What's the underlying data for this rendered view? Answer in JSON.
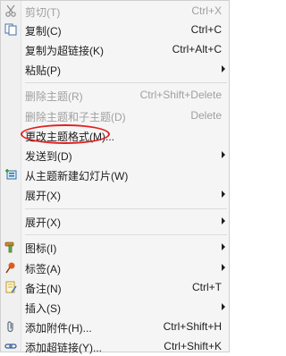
{
  "menu": {
    "items": [
      {
        "label": "剪切(T)",
        "shortcut": "Ctrl+X",
        "disabled": true,
        "icon": "scissors-icon"
      },
      {
        "label": "复制(C)",
        "shortcut": "Ctrl+C",
        "disabled": false,
        "icon": "copy-icon"
      },
      {
        "label": "复制为超链接(K)",
        "shortcut": "Ctrl+Alt+C",
        "disabled": false
      },
      {
        "label": "粘贴(P)",
        "shortcut": "",
        "disabled": false,
        "submenu": true
      },
      {
        "label": "删除主题(R)",
        "shortcut": "Ctrl+Shift+Delete",
        "disabled": true
      },
      {
        "label": "删除主题和子主题(D)",
        "shortcut": "Delete",
        "disabled": true
      },
      {
        "label": "更改主题格式(M)...",
        "shortcut": "",
        "disabled": false
      },
      {
        "label": "发送到(D)",
        "shortcut": "",
        "disabled": false,
        "submenu": true
      },
      {
        "label": "从主题新建幻灯片(W)",
        "shortcut": "",
        "disabled": false,
        "icon": "new-slide-icon"
      },
      {
        "label": "展开(X)",
        "shortcut": "",
        "disabled": false,
        "submenu": true
      },
      {
        "label": "展开(X)",
        "shortcut": "",
        "disabled": false,
        "submenu": true
      },
      {
        "label": "图标(I)",
        "shortcut": "",
        "disabled": false,
        "submenu": true,
        "icon": "hammer-icon"
      },
      {
        "label": "标签(A)",
        "shortcut": "",
        "disabled": false,
        "submenu": true,
        "icon": "pin-icon"
      },
      {
        "label": "备注(N)",
        "shortcut": "Ctrl+T",
        "disabled": false,
        "icon": "note-icon"
      },
      {
        "label": "插入(S)",
        "shortcut": "",
        "disabled": false,
        "submenu": true
      },
      {
        "label": "添加附件(H)...",
        "shortcut": "Ctrl+Shift+H",
        "disabled": false,
        "icon": "paperclip-icon"
      },
      {
        "label": "添加超链接(Y)...",
        "shortcut": "Ctrl+Shift+K",
        "disabled": false,
        "icon": "link-icon"
      }
    ]
  },
  "colors": {
    "highlight_ring": "#e02020"
  }
}
